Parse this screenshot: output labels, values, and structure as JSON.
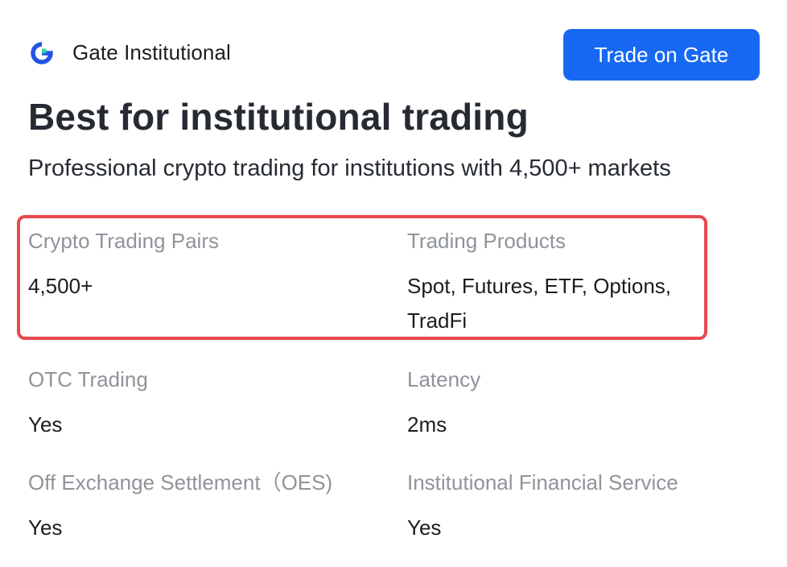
{
  "header": {
    "brand_name": "Gate Institutional",
    "logo_icon": "gate-logo-icon",
    "cta_label": "Trade on Gate"
  },
  "hero": {
    "title": "Best for institutional trading",
    "subtitle": "Professional crypto trading for institutions with 4,500+ markets"
  },
  "features": [
    {
      "label": "Crypto Trading Pairs",
      "value": "4,500+"
    },
    {
      "label": "Trading Products",
      "value": "Spot, Futures, ETF, Options, TradFi"
    },
    {
      "label": "OTC Trading",
      "value": "Yes"
    },
    {
      "label": "Latency",
      "value": "2ms"
    },
    {
      "label": "Off Exchange Settlement（OES)",
      "value": "Yes"
    },
    {
      "label": "Institutional Financial Service",
      "value": "Yes"
    }
  ],
  "colors": {
    "accent": "#1768f2",
    "highlight_border": "#e8494d",
    "label_gray": "#8f939a",
    "logo_blue": "#2354e6",
    "logo_green": "#2fd3a6"
  }
}
